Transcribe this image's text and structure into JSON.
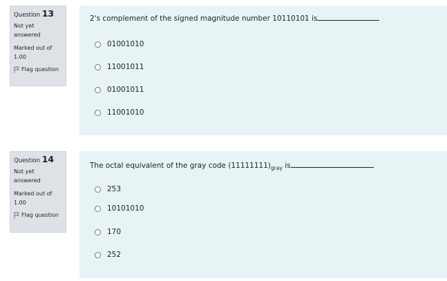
{
  "questions": [
    {
      "number_prefix": "Question",
      "number": "13",
      "state": "Not yet answered",
      "grade": "Marked out of 1.00",
      "flag_label": "Flag question",
      "text": "2's complement of the signed magnitude number 10110101 is",
      "options": [
        "01001010",
        "11001011",
        "01001011",
        "11001010"
      ]
    },
    {
      "number_prefix": "Question",
      "number": "14",
      "state": "Not yet answered",
      "grade": "Marked out of 1.00",
      "flag_label": "Flag question",
      "text_main": "The octal equivalent of the gray code (11111111)",
      "text_sub": "gray",
      "text_tail": " is",
      "options": [
        "253",
        "10101010",
        "170",
        "252"
      ]
    }
  ]
}
